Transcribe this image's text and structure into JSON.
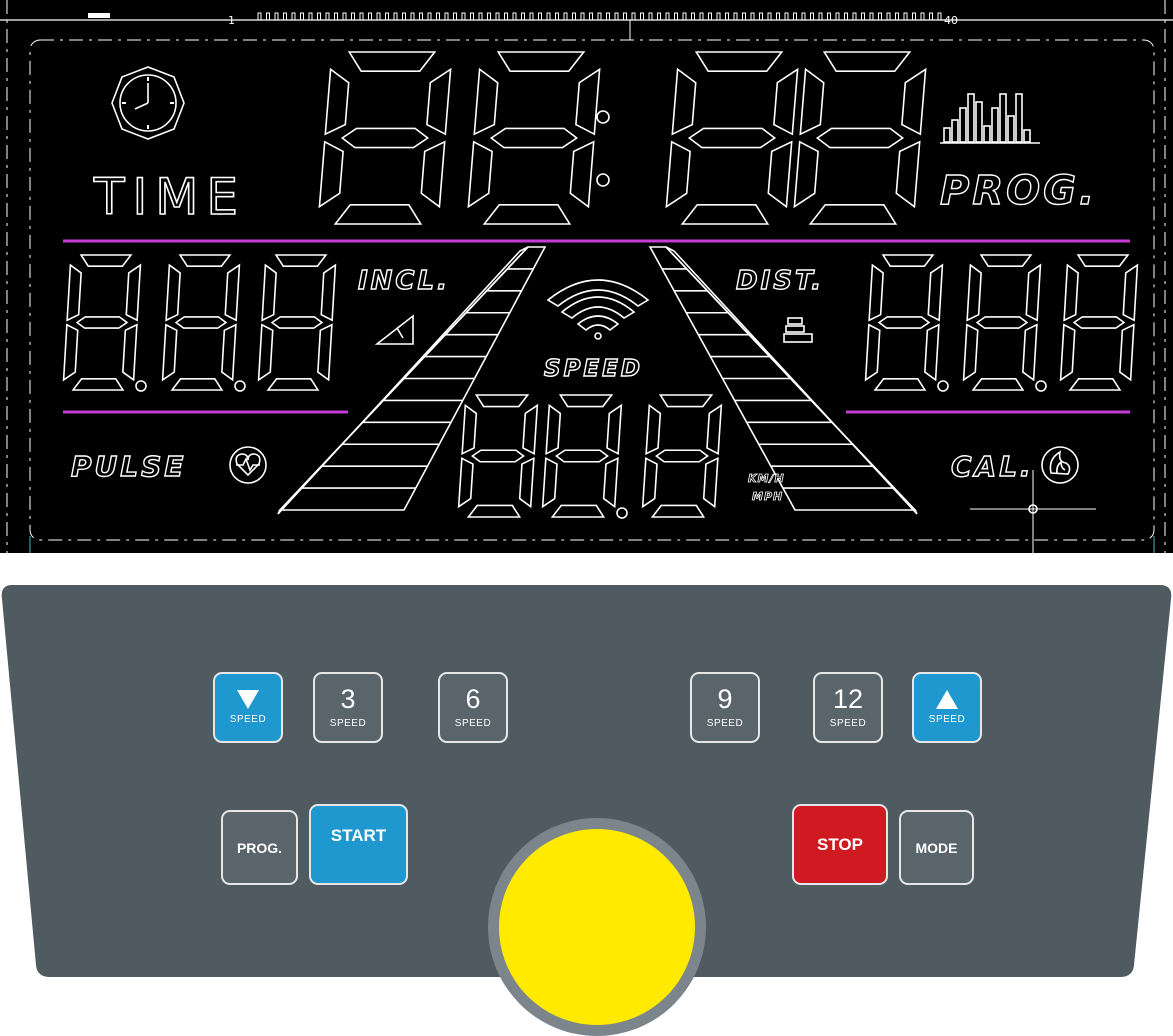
{
  "lcd": {
    "time_label": "TIME",
    "prog_label": "PROG.",
    "incl_label": "INCL.",
    "dist_label": "DIST.",
    "speed_label": "SPEED",
    "pulse_label": "PULSE",
    "cal_label": "CAL.",
    "unit_kmh": "KM/H",
    "unit_mph": "MPH",
    "ruler_start": "1",
    "ruler_end": "40",
    "main_time": "88:88",
    "incline_value": "8.8.8",
    "distance_value": "8.8.8",
    "speed_value": "88.8",
    "accent_color": "#c53bd3",
    "icons": [
      "clock-icon",
      "program-bars-icon",
      "incline-icon",
      "distance-icon",
      "speed-wave-icon",
      "heart-icon",
      "calorie-icon"
    ]
  },
  "keypad": {
    "speed_label": "SPEED",
    "speed_down": {
      "icon": "arrow-down-icon",
      "sub": "SPEED"
    },
    "speed_3": {
      "value": "3",
      "sub": "SPEED"
    },
    "speed_6": {
      "value": "6",
      "sub": "SPEED"
    },
    "speed_9": {
      "value": "9",
      "sub": "SPEED"
    },
    "speed_12": {
      "value": "12",
      "sub": "SPEED"
    },
    "speed_up": {
      "icon": "arrow-up-icon",
      "sub": "SPEED"
    },
    "prog": "PROG.",
    "start": "START",
    "stop": "STOP",
    "mode": "MODE",
    "colors": {
      "panel": "#4f5a61",
      "grey_key": "#59646b",
      "blue_key": "#1f97cf",
      "red_key": "#cf1a22",
      "emergency_button": "#ffea00"
    }
  }
}
